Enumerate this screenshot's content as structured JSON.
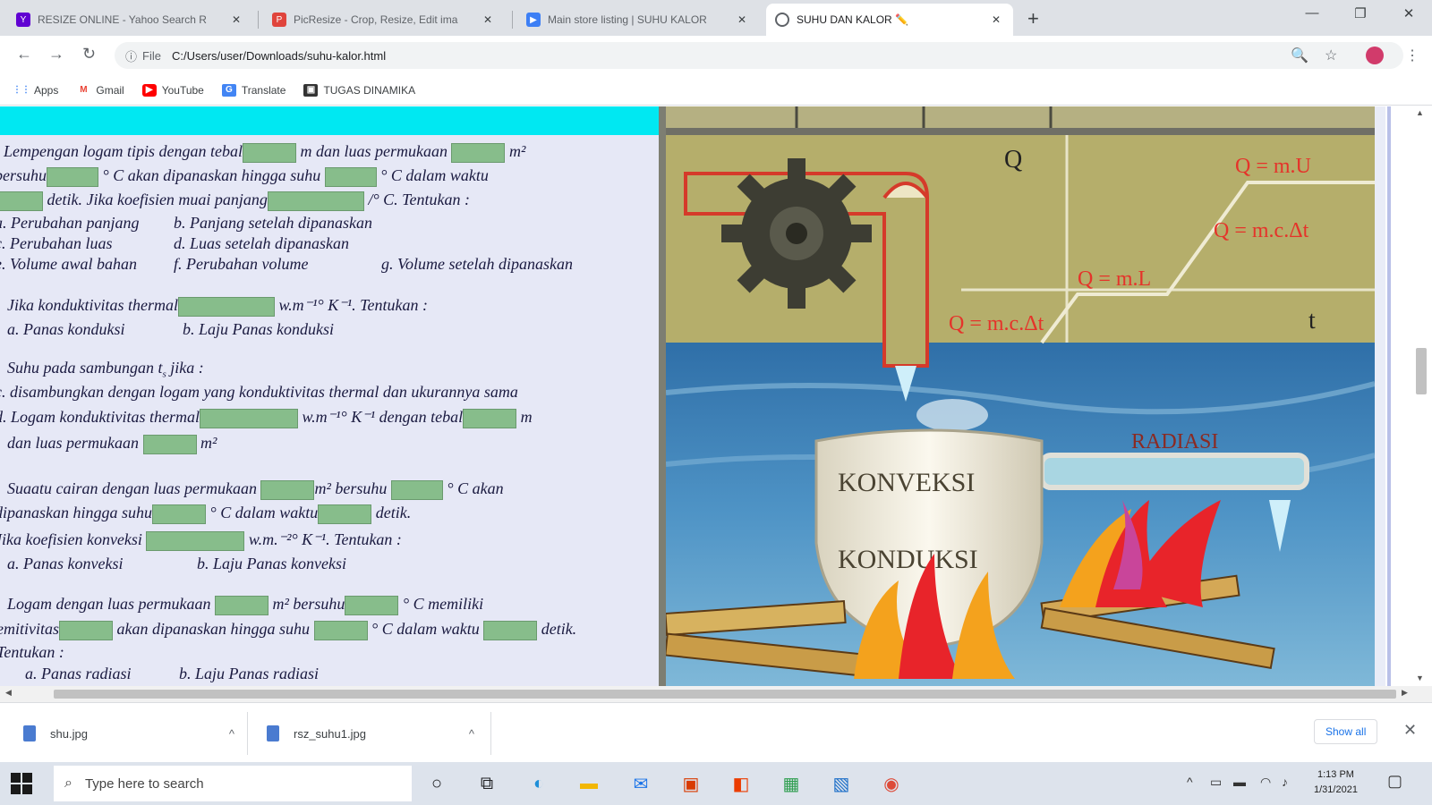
{
  "browser": {
    "tabs": [
      {
        "title": "RESIZE ONLINE - Yahoo Search R",
        "icon": "yahoo-icon",
        "color": "#6001d2"
      },
      {
        "title": "PicResize - Crop, Resize, Edit ima",
        "icon": "picresize-icon",
        "color": "#e0443c"
      },
      {
        "title": "Main store listing | SUHU KALOR",
        "icon": "play-console-icon",
        "color": "#3d7ff5"
      },
      {
        "title": "SUHU DAN KALOR ✏️",
        "icon": "globe-icon",
        "color": "#5f6368"
      }
    ],
    "file_label": "File",
    "url": "C:/Users/user/Downloads/suhu-kalor.html",
    "bookmarks": [
      {
        "label": "Apps",
        "icon": "apps-grid-icon"
      },
      {
        "label": "Gmail",
        "icon": "gmail-icon"
      },
      {
        "label": "YouTube",
        "icon": "youtube-icon"
      },
      {
        "label": "Translate",
        "icon": "translate-icon"
      },
      {
        "label": "TUGAS DINAMIKA",
        "icon": "bookmark-folder-icon"
      }
    ]
  },
  "content": {
    "q1": {
      "l1a": "Lempengan logam tipis dengan tebal",
      "l1b": "m dan luas permukaan",
      "l1c": "m²",
      "l2a": "bersuhu",
      "l2b": "° C akan dipanaskan hingga suhu",
      "l2c": "° C dalam waktu",
      "l3a": "detik. Jika koefisien muai panjang",
      "l3b": "/° C. Tentukan :",
      "o1a": "a. Perubahan panjang",
      "o1b": "b. Panjang setelah dipanaskan",
      "o2a": "c. Perubahan luas",
      "o2b": "d. Luas setelah dipanaskan",
      "o3a": "e. Volume awal bahan",
      "o3b": "f. Perubahan volume",
      "o3c": "g. Volume setelah dipanaskan"
    },
    "q2": {
      "l1a": "Jika konduktivitas thermal",
      "l1b": "w.m⁻¹° K⁻¹. Tentukan :",
      "oa": "a. Panas konduksi",
      "ob": "b. Laju Panas konduksi"
    },
    "q3": {
      "l1": "Suhu pada sambungan t",
      "l1sub": "s",
      "l1b": " jika :",
      "l2": "c. disambungkan dengan logam yang konduktivitas thermal dan ukurannya sama",
      "l3a": "d. Logam konduktivitas thermal",
      "l3b": "w.m⁻¹° K⁻¹ dengan tebal",
      "l3c": "m",
      "l4a": "dan luas permukaan",
      "l4b": "m²"
    },
    "q4": {
      "l1a": "Suaatu cairan dengan luas permukaan",
      "l1b": "m² bersuhu",
      "l1c": "° C akan",
      "l2a": "dipanaskan hingga suhu",
      "l2b": "° C dalam waktu",
      "l2c": "detik.",
      "l3a": "Jika koefisien konveksi",
      "l3b": "w.m.⁻²° K⁻¹. Tentukan :",
      "oa": "a. Panas konveksi",
      "ob": "b. Laju Panas konveksi"
    },
    "q5": {
      "l1a": "Logam dengan luas permukaan",
      "l1b": "m² bersuhu",
      "l1c": "° C memiliki",
      "l2a": "emitivitas",
      "l2b": "akan dipanaskan hingga suhu",
      "l2c": "° C dalam waktu",
      "l2d": "detik.",
      "l3": "Tentukan :",
      "oa": "a. Panas radiasi",
      "ob": "b. Laju Panas radiasi"
    }
  },
  "illustration": {
    "graph_q": "Q",
    "graph_t": "t",
    "eq1": "Q = m.c.Δt",
    "eq2": "Q = m.L",
    "eq3": "Q = m.c.Δt",
    "eq4": "Q = m.U",
    "label_konveksi": "KONVEKSI",
    "label_konduksi": "KONDUKSI",
    "label_radiasi": "RADIASI"
  },
  "downloads": {
    "items": [
      {
        "name": "shu.jpg"
      },
      {
        "name": "rsz_suhu1.jpg"
      }
    ],
    "show_all": "Show all"
  },
  "taskbar": {
    "search_placeholder": "Type here to search",
    "time": "1:13 PM",
    "date": "1/31/2021"
  }
}
